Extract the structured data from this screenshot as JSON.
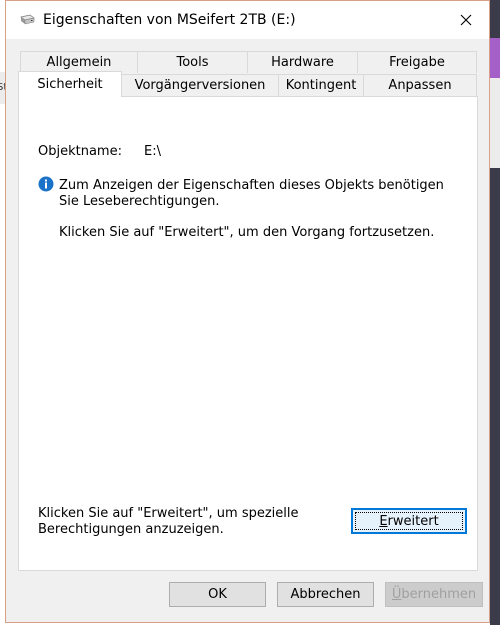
{
  "window": {
    "title": "Eigenschaften von MSeifert 2TB (E:)"
  },
  "desktop": {
    "left_edge_text": "St"
  },
  "tabs": {
    "row1": [
      "Allgemein",
      "Tools",
      "Hardware",
      "Freigabe"
    ],
    "row2": [
      "Sicherheit",
      "Vorgängerversionen",
      "Kontingent",
      "Anpassen"
    ],
    "active": "Sicherheit"
  },
  "security": {
    "object_name_label": "Objektname:",
    "object_name_value": "E:\\",
    "info_message": "Zum Anzeigen der Eigenschaften dieses Objekts benötigen Sie Leseberechtigungen.",
    "info_hint": "Klicken Sie auf \"Erweitert\", um den Vorgang fortzusetzen.",
    "advanced_text": "Klicken Sie auf \"Erweitert\", um spezielle Berechtigungen anzuzeigen.",
    "advanced_button": {
      "pre": "",
      "accel": "E",
      "post": "rweitert"
    }
  },
  "buttons": {
    "ok": "OK",
    "cancel": "Abbrechen",
    "apply": {
      "pre": "",
      "accel": "Ü",
      "post": "bernehmen"
    }
  },
  "colors": {
    "accent": "#0078d7",
    "info_icon": "#1a73c9",
    "window_border": "#d9a089"
  },
  "icons": [
    "drive-icon",
    "close-icon",
    "info-icon"
  ]
}
